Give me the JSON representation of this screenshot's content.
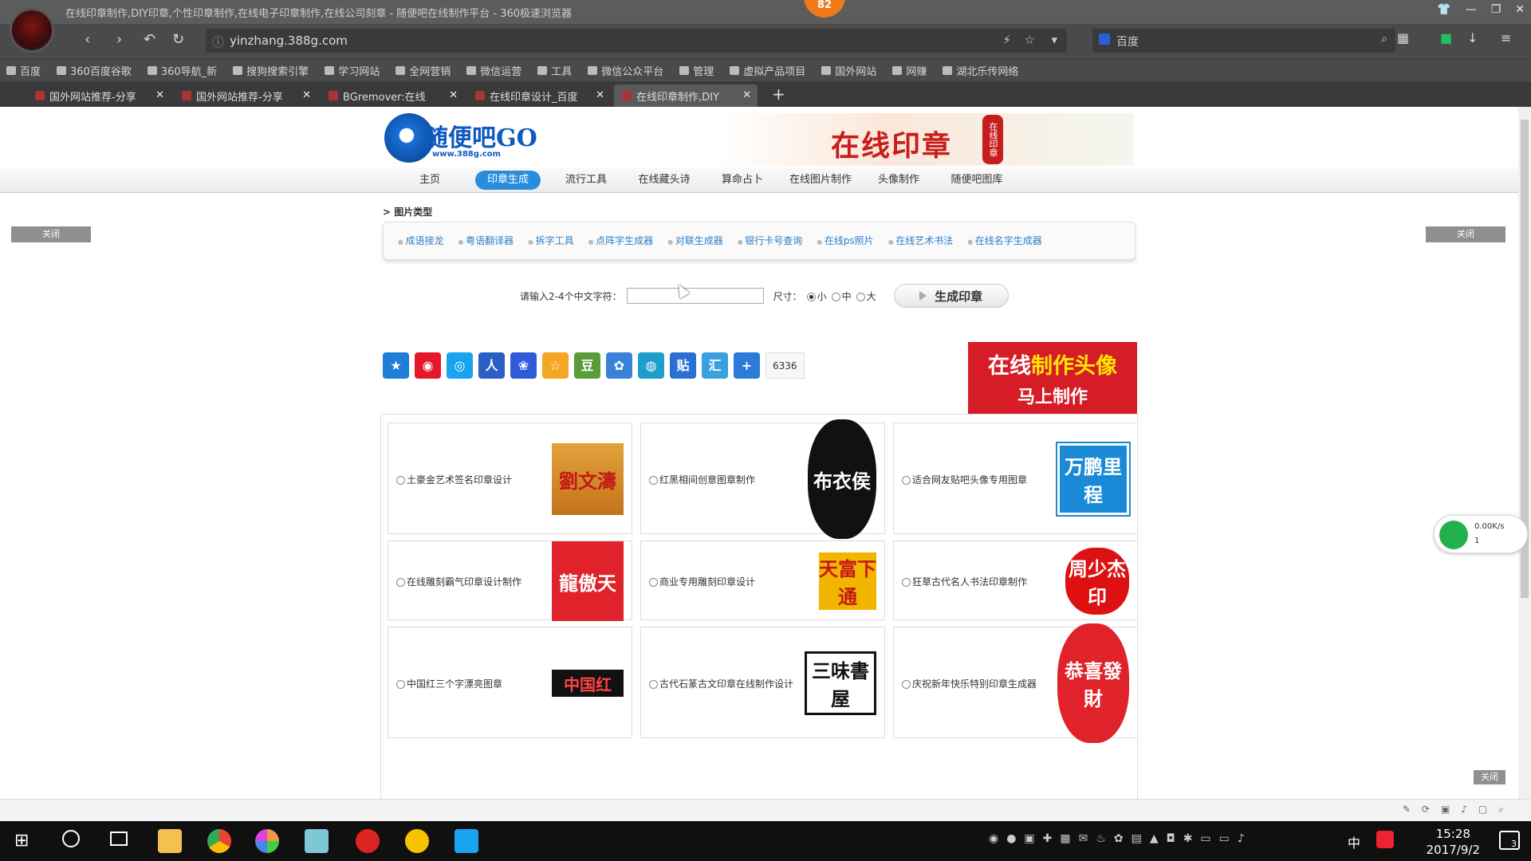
{
  "browser": {
    "window_title": "在线印章制作,DIY印章,个性印章制作,在线电子印章制作,在线公司刻章 - 随便吧在线制作平台 - 360极速浏览器",
    "badge": "82",
    "url": "yinzhang.388g.com",
    "search_engine": "百度",
    "bookmarks": [
      "百度",
      "360百度谷歌",
      "360导航_新",
      "搜狗搜索引擎",
      "学习网站",
      "全网营销",
      "微信运营",
      "工具",
      "微信公众平台",
      "管理",
      "虚拟产品项目",
      "国外网站",
      "网赚",
      "湖北乐传网络"
    ],
    "tabs": [
      {
        "label": "国外网站推荐-分享"
      },
      {
        "label": "国外网站推荐-分享"
      },
      {
        "label": "BGremover:在线"
      },
      {
        "label": "在线印章设计_百度"
      },
      {
        "label": "在线印章制作,DIY",
        "active": true
      }
    ],
    "new_tab": "+",
    "close_glyph": "✕"
  },
  "site": {
    "logo_text": "随便吧GO",
    "logo_url_text": "www.388g.com",
    "banner_title": "在线印章",
    "banner_seal": "在线印章",
    "menu": [
      "主页",
      "印章生成",
      "流行工具",
      "在线藏头诗",
      "算命占卜",
      "在线图片制作",
      "头像制作",
      "随便吧图库"
    ],
    "menu_selected": "印章生成",
    "breadcrumb": "> 图片类型",
    "categories": [
      "成语接龙",
      "粤语翻译器",
      "拆字工具",
      "点阵字生成器",
      "对联生成器",
      "银行卡号查询",
      "在线ps照片",
      "在线艺术书法",
      "在线名字生成器"
    ],
    "close_label": "关闭",
    "form": {
      "prompt": "请输入2-4个中文字符：",
      "input_value": "",
      "size_label": "尺寸：",
      "sizes": [
        "小",
        "中",
        "大"
      ],
      "size_selected": "小",
      "generate": "生成印章"
    },
    "share_icons": [
      "qzone-icon",
      "weibo-icon",
      "tqq-icon",
      "renren-icon",
      "baidu-icon",
      "qq-star-icon",
      "douban-icon",
      "kaixin-icon",
      "pengyou-icon",
      "tieba-icon",
      "hexun-icon",
      "more-plus-icon"
    ],
    "share_count": "6336",
    "ad": {
      "line1_a": "在线",
      "line1_b": "制作头像",
      "line2": "马上制作"
    },
    "cards": [
      {
        "label": "土豪金艺术签名印章设计",
        "stamp": "劉文濤"
      },
      {
        "label": "红黑相间创意图章制作",
        "stamp": "布衣侯"
      },
      {
        "label": "适合网友贴吧头像专用图章",
        "stamp": "万鹏里程"
      },
      {
        "label": "在线雕刻霸气印章设计制作",
        "stamp": "龍傲天"
      },
      {
        "label": "商业专用雕刻印章设计",
        "stamp": "天富下通"
      },
      {
        "label": "狂草古代名人书法印章制作",
        "stamp": "周少杰印"
      },
      {
        "label": "中国红三个字漂亮图章",
        "stamp": "中国红"
      },
      {
        "label": "古代石篆古文印章在线制作设计",
        "stamp": "三味書屋"
      },
      {
        "label": "庆祝新年快乐特别印章生成器",
        "stamp": "恭喜發財"
      }
    ],
    "network_widget": {
      "speed": "0.00K/s",
      "count": "1"
    }
  },
  "taskbar": {
    "time": "15:28",
    "date": "2017/9/2",
    "ime": "中",
    "notifications": "3"
  },
  "colors": {
    "accent": "#2a8ddc",
    "ad_red": "#d61d27",
    "stamp_red": "#e0222a"
  }
}
